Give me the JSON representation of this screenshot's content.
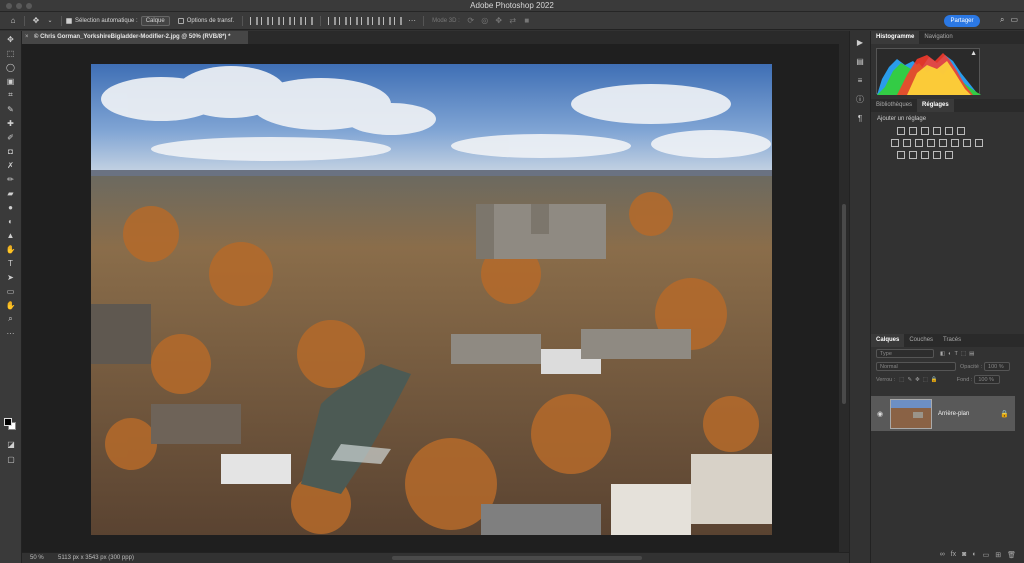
{
  "app": {
    "title": "Adobe Photoshop 2022"
  },
  "options_bar": {
    "auto_select_label": "Sélection automatique :",
    "auto_select_value": "Calque",
    "transform_label": "Options de transf.",
    "mode3d_label": "Mode 3D :",
    "share_label": "Partager"
  },
  "document": {
    "tab_title": "© Chris Gorman_YorkshireBigladder-Modifier-2.jpg @ 50% (RVB/8*) *",
    "zoom": "50 %",
    "dimensions": "5113 px x 3543 px (300 ppp)"
  },
  "panels": {
    "top_tabs": [
      "Histogramme",
      "Navigation"
    ],
    "mid_tabs": [
      "Bibliothèques",
      "Réglages"
    ],
    "adjust_title": "Ajouter un réglage",
    "layer_tabs": [
      "Calques",
      "Couches",
      "Tracés"
    ],
    "kind_placeholder": "Type",
    "blend_mode": "Normal",
    "opacity_label": "Opacité :",
    "opacity_value": "100 %",
    "lock_label": "Verrou :",
    "fill_label": "Fond :",
    "fill_value": "100 %",
    "layer_name": "Arrière-plan"
  },
  "colors": {
    "accent": "#2b78e4",
    "panel": "#323232",
    "canvas": "#1f1f1f"
  }
}
